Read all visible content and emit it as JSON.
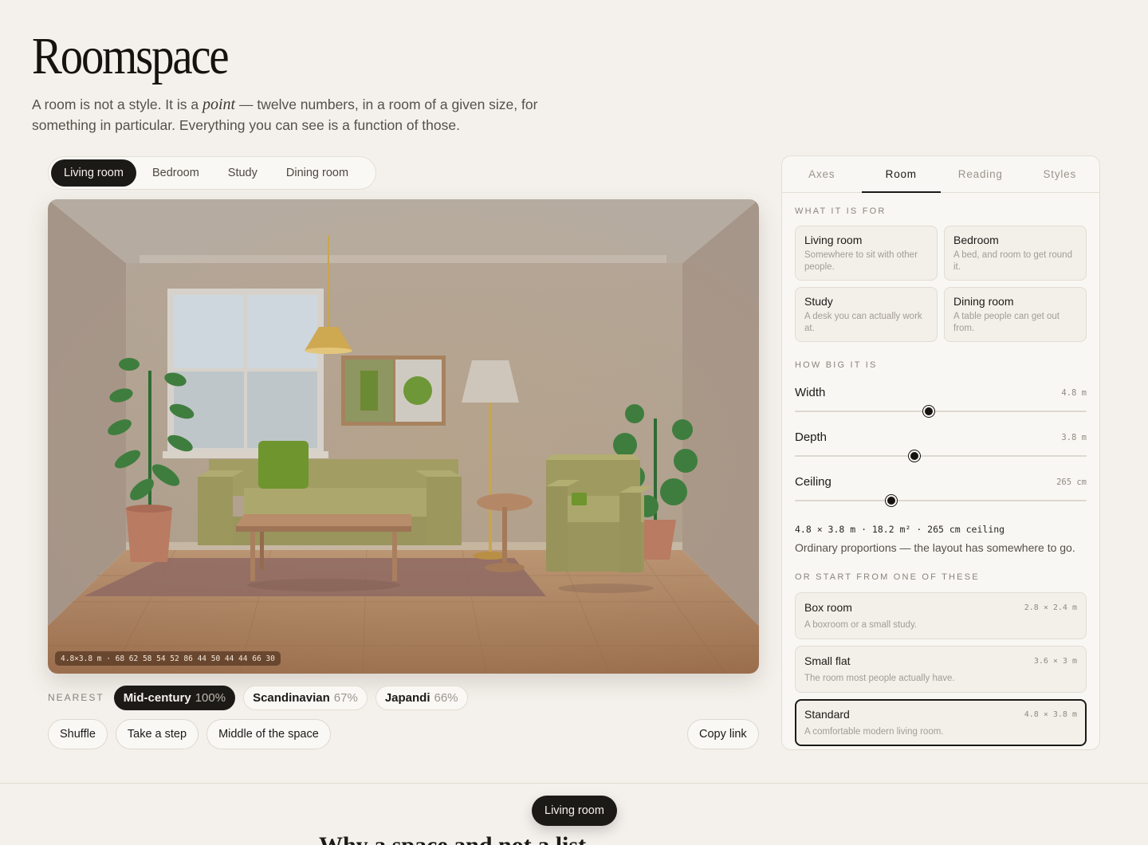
{
  "header": {
    "title": "Roomspace",
    "subtitle_pre": "A room is not a style. It is a ",
    "subtitle_em": "point",
    "subtitle_post": " — twelve numbers, in a room of a given size, for something in particular. Everything you can see is a function of those."
  },
  "room_tabs": [
    {
      "label": "Living room",
      "active": true
    },
    {
      "label": "Bedroom",
      "active": false
    },
    {
      "label": "Study",
      "active": false
    },
    {
      "label": "Dining room",
      "active": false
    }
  ],
  "scene": {
    "readout": "4.8×3.8 m · 68 62 58 54 52 86 44 50 44 44 66 30"
  },
  "nearest": {
    "label": "NEAREST",
    "items": [
      {
        "name": "Mid-century",
        "pct": "100%",
        "active": true
      },
      {
        "name": "Scandinavian",
        "pct": "67%",
        "active": false
      },
      {
        "name": "Japandi",
        "pct": "66%",
        "active": false
      }
    ]
  },
  "actions": {
    "shuffle": "Shuffle",
    "step": "Take a step",
    "middle": "Middle of the space",
    "copy": "Copy link"
  },
  "panel": {
    "tabs": [
      {
        "label": "Axes",
        "active": false
      },
      {
        "label": "Room",
        "active": true
      },
      {
        "label": "Reading",
        "active": false
      },
      {
        "label": "Styles",
        "active": false
      }
    ],
    "purpose_label": "WHAT IT IS FOR",
    "purposes": [
      {
        "title": "Living room",
        "desc": "Somewhere to sit with other people."
      },
      {
        "title": "Bedroom",
        "desc": "A bed, and room to get round it."
      },
      {
        "title": "Study",
        "desc": "A desk you can actually work at."
      },
      {
        "title": "Dining room",
        "desc": "A table people can get out from."
      }
    ],
    "size_label": "HOW BIG IT IS",
    "sliders": [
      {
        "label": "Width",
        "value": "4.8 m",
        "fraction": 0.46
      },
      {
        "label": "Depth",
        "value": "3.8 m",
        "fraction": 0.41
      },
      {
        "label": "Ceiling",
        "value": "265 cm",
        "fraction": 0.33
      }
    ],
    "dims_line": "4.8 × 3.8 m · 18.2 m² · 265 cm ceiling",
    "dims_note": "Ordinary proportions — the layout has somewhere to go.",
    "presets_label": "OR START FROM ONE OF THESE",
    "presets": [
      {
        "name": "Box room",
        "dims": "2.8 × 2.4 m",
        "desc": "A boxroom or a small study.",
        "active": false
      },
      {
        "name": "Small flat",
        "dims": "3.6 × 3 m",
        "desc": "The room most people actually have.",
        "active": false
      },
      {
        "name": "Standard",
        "dims": "4.8 × 3.8 m",
        "desc": "A comfortable modern living room.",
        "active": true
      }
    ]
  },
  "footer": {
    "pill": "Living room",
    "heading": "Why a space and not a list"
  },
  "colors": {
    "ink": "#1c1a17",
    "paper": "#f4f1ec",
    "wall": "#ad9f92",
    "floor": "#a77d5b",
    "sofa": "#a8a468",
    "plant": "#3f7d3f"
  },
  "icons": [
    "pendant-lamp-icon",
    "floor-lamp-icon",
    "plant-icon"
  ]
}
